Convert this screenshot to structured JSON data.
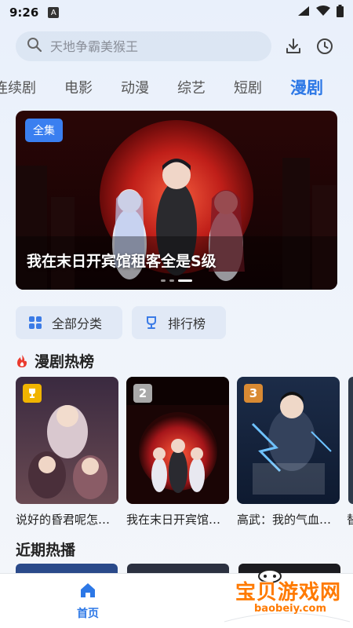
{
  "status_bar": {
    "time": "9:26",
    "notif": "A"
  },
  "search": {
    "placeholder": "天地争霸美猴王"
  },
  "tabs": [
    {
      "label": "连续剧"
    },
    {
      "label": "电影"
    },
    {
      "label": "动漫"
    },
    {
      "label": "综艺"
    },
    {
      "label": "短剧"
    },
    {
      "label": "漫剧"
    }
  ],
  "banner": {
    "badge": "全集",
    "title": "我在末日开宾馆租客全是S级"
  },
  "quick": {
    "categories": "全部分类",
    "ranking": "排行榜"
  },
  "hot_section": {
    "title": "漫剧热榜",
    "items": [
      {
        "rank": "",
        "title": "说好的昏君呢怎…"
      },
      {
        "rank": "2",
        "title": "我在末日开宾馆…"
      },
      {
        "rank": "3",
        "title": "高武：我的气血…"
      }
    ],
    "partial_title": "替"
  },
  "recent_section": {
    "title": "近期热播"
  },
  "bottom_nav": {
    "home": "首页"
  },
  "watermark": {
    "brand": "宝贝游戏网",
    "url": "baobeiy.com"
  },
  "colors": {
    "accent": "#2d78e6",
    "banner_badge": "#3a7ff0"
  }
}
